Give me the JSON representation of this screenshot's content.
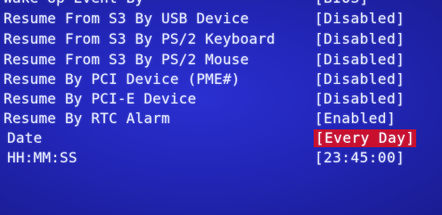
{
  "settings": [
    {
      "label": "Wake Up Event By",
      "value": "[BIOS]"
    },
    {
      "label": "Resume From S3 By USB Device",
      "value": "[Disabled]"
    },
    {
      "label": "Resume From S3 By PS/2 Keyboard",
      "value": "[Disabled]"
    },
    {
      "label": "Resume From S3 By PS/2 Mouse",
      "value": "[Disabled]"
    },
    {
      "label": "Resume By PCI Device (PME#)",
      "value": "[Disabled]"
    },
    {
      "label": "Resume By PCI-E Device",
      "value": "[Disabled]"
    },
    {
      "label": "Resume By RTC Alarm",
      "value": "[Enabled]"
    },
    {
      "label": "Date",
      "value": "[Every Day]",
      "selected": true
    },
    {
      "label": "HH:MM:SS",
      "value": "[23:45:00]"
    }
  ],
  "colors": {
    "background": "#2226b8",
    "text": "#e8ecff",
    "highlight": "#c8102e"
  }
}
